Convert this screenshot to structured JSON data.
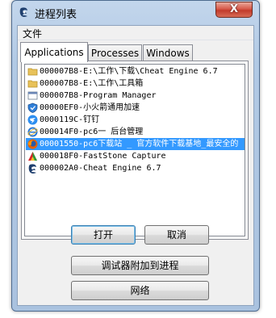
{
  "window": {
    "title": "进程列表",
    "close_label": "X"
  },
  "menu": {
    "file": "文件"
  },
  "tabs": [
    {
      "label": "Applications",
      "active": true
    },
    {
      "label": "Processes",
      "active": false
    },
    {
      "label": "Windows",
      "active": false
    }
  ],
  "process_list": [
    {
      "text": "000007B8-E:\\工作\\下载\\Cheat Engine 6.7",
      "icon": "folder-icon",
      "selected": false
    },
    {
      "text": "000007B8-E:\\工作\\工具箱",
      "icon": "folder-icon",
      "selected": false
    },
    {
      "text": "000007B8-Program Manager",
      "icon": "window-icon",
      "selected": false
    },
    {
      "text": "00000EF0-小火箭通用加速",
      "icon": "shield-icon",
      "selected": false
    },
    {
      "text": "0000119C-钉钉",
      "icon": "dingtalk-icon",
      "selected": false
    },
    {
      "text": "000014F0-pc6一 后台管理",
      "icon": "ie-icon",
      "selected": false
    },
    {
      "text": "00001550-pc6下载站 _ 官方软件下载基地_最安全的",
      "icon": "firefox-icon",
      "selected": true
    },
    {
      "text": "000018F0-FastStone Capture",
      "icon": "faststone-icon",
      "selected": false
    },
    {
      "text": "000002A0-Cheat Engine 6.7",
      "icon": "cheat-engine-icon",
      "selected": false
    }
  ],
  "buttons": {
    "open": "打开",
    "cancel": "取消",
    "attach_debugger": "调试器附加到进程",
    "network": "网络"
  },
  "colors": {
    "selection": "#3399ff",
    "title_bar": "#b1c9e4",
    "close_button": "#c23b2b"
  }
}
